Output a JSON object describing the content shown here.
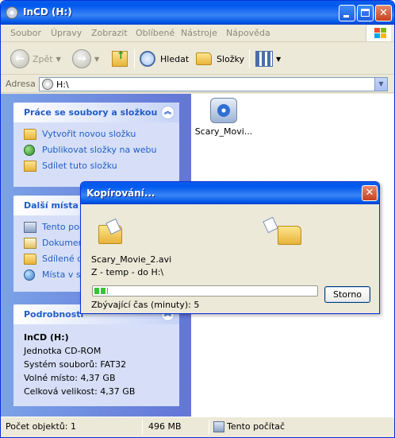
{
  "window": {
    "title": "InCD (H:)"
  },
  "menu": [
    "Soubor",
    "Úpravy",
    "Zobrazit",
    "Oblíbené",
    "Nástroje",
    "Nápověda"
  ],
  "toolbar": {
    "back": "Zpět",
    "search": "Hledat",
    "folders": "Složky"
  },
  "address": {
    "label": "Adresa",
    "value": "H:\\"
  },
  "panels": {
    "tasks": {
      "title": "Práce se soubory a složkou",
      "items": [
        "Vytvořit novou složku",
        "Publikovat složky na webu",
        "Sdílet tuto složku"
      ]
    },
    "places": {
      "title": "Další místa",
      "items": [
        "Tento počítač",
        "Dokumenty",
        "Sdílené dokumenty",
        "Místa v síti"
      ]
    },
    "details": {
      "title": "Podrobnosti",
      "name": "InCD (H:)",
      "type": "Jednotka CD-ROM",
      "filesystem": "Systém souborů: FAT32",
      "free": "Volné místo: 4,37 GB",
      "total": "Celková velikost: 4,37 GB"
    }
  },
  "files": [
    {
      "name": "Scary_Movi...",
      "icon": "media-file-icon"
    }
  ],
  "status": {
    "count": "Počet objektů: 1",
    "size": "496 MB",
    "location": "Tento počítač"
  },
  "dialog": {
    "title": "Kopírování...",
    "file": "Scary_Movie_2.avi",
    "route": "Z - temp - do H:\\",
    "progress": 0.06,
    "remaining": "Zbývající čas (minuty): 5",
    "cancel": "Storno"
  },
  "colors": {
    "titlebar": "#0058ee",
    "sidepane": "#7ba2e7",
    "panel_link": "#215dc6",
    "progress": "#37c437"
  }
}
